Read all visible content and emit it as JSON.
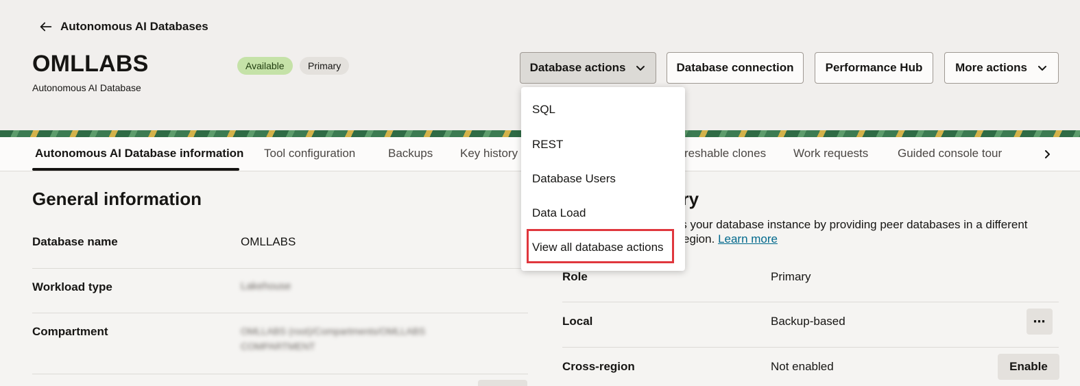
{
  "header": {
    "back_label": "Autonomous AI Databases",
    "title": "OMLLABS",
    "subtitle": "Autonomous AI Database",
    "badges": {
      "status": "Available",
      "role": "Primary"
    },
    "buttons": {
      "database_actions": "Database actions",
      "database_connection": "Database connection",
      "performance_hub": "Performance Hub",
      "more_actions": "More actions"
    }
  },
  "menu": {
    "items": [
      "SQL",
      "REST",
      "Database Users",
      "Data Load",
      "View all database actions"
    ]
  },
  "tabs": [
    "Autonomous AI Database information",
    "Tool configuration",
    "Backups",
    "Key history",
    "reshable clones",
    "Work requests",
    "Guided console tour"
  ],
  "general": {
    "title": "General information",
    "rows": [
      {
        "label": "Database name",
        "value": "OMLLABS"
      },
      {
        "label": "Workload type",
        "value": "Lakehouse"
      },
      {
        "label": "Compartment",
        "value": "OMLLABS (root)/Compartments/OMLLABS",
        "value2": "COMPARTMENT"
      }
    ]
  },
  "recovery": {
    "title_partial": "ery",
    "help_line1": "cts your database instance by providing peer databases in a different",
    "help_line2": "egion.",
    "learn_more": "Learn more",
    "rows": [
      {
        "label": "Role",
        "value": "Primary"
      },
      {
        "label": "Local",
        "value": "Backup-based"
      },
      {
        "label": "Cross-region",
        "value": "Not enabled"
      }
    ],
    "enable_label": "Enable",
    "kebab_glyph": "⋯"
  },
  "colors": {
    "highlight": "#e0373d",
    "link": "#00688c",
    "available_badge": "#c5e2a8"
  }
}
